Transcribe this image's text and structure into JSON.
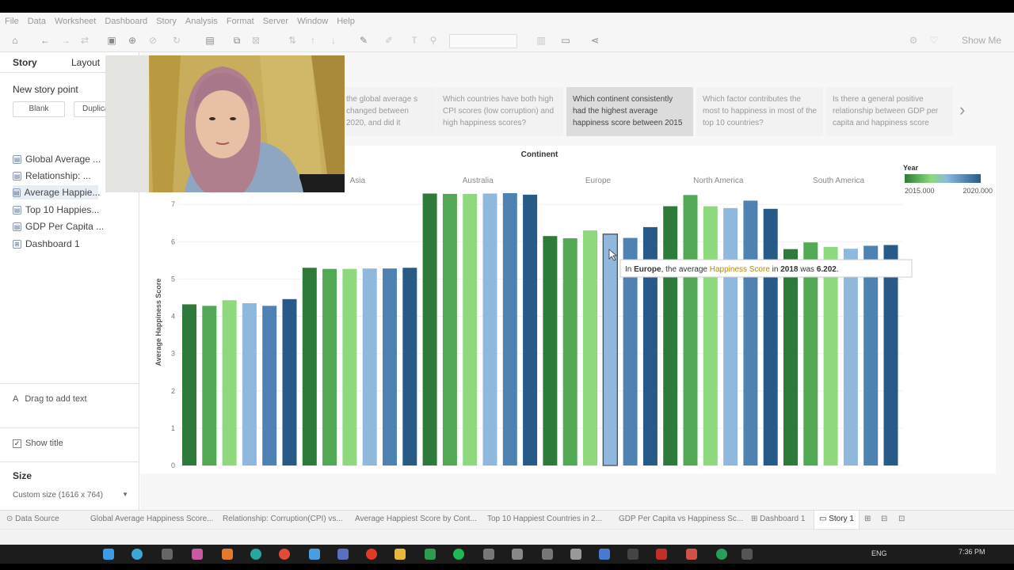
{
  "menu": [
    "File",
    "Data",
    "Worksheet",
    "Dashboard",
    "Story",
    "Analysis",
    "Format",
    "Server",
    "Window",
    "Help"
  ],
  "toolbar": {
    "show_me": "Show Me"
  },
  "left_panel": {
    "tab_story": "Story",
    "tab_layout": "Layout",
    "new_story_point": "New story point",
    "blank_button": "Blank",
    "duplicate_button": "Duplicate",
    "sheets": [
      "Global Average ...",
      "Relationship: ...",
      "Average Happie...",
      "Top 10 Happies...",
      "GDP Per Capita ...",
      "Dashboard 1"
    ],
    "drag_to_add_text": "Drag to add text",
    "show_title": "Show title",
    "size_heading": "Size",
    "size_value": "Custom size (1616 x 764)"
  },
  "story_points": [
    "the global average s changed between 2020, and did it",
    "Which countries have both high CPI scores (low corruption) and high happiness scores?",
    "Which continent consistently had the highest average happiness score between 2015",
    "Which factor contributes the most to happiness in most of the top 10 countries?",
    "Is there a general positive relationship between GDP per capita and happiness score"
  ],
  "active_story_point": 2,
  "tooltip": {
    "prefix": "In ",
    "continent": "Europe",
    "mid": ", the average ",
    "measure": "Happiness Score",
    "mid2": " in ",
    "year": "2018",
    "mid3": " was ",
    "value": "6.202",
    "suffix": "."
  },
  "chart_data": {
    "type": "bar",
    "header_title": "Continent",
    "ylabel": "Average Happiness Score",
    "ylim": [
      0,
      7.3
    ],
    "yticks": [
      0,
      1,
      2,
      3,
      4,
      5,
      6,
      7
    ],
    "legend": {
      "title": "Year",
      "min_label": "2015.000",
      "max_label": "2020.000"
    },
    "years": [
      2015,
      2016,
      2017,
      2018,
      2019,
      2020
    ],
    "year_colors": [
      "#2d7a3a",
      "#52a855",
      "#8ed97e",
      "#8fb8dc",
      "#4d82b3",
      "#285a88"
    ],
    "groups": [
      {
        "name": "",
        "values": [
          4.32,
          4.28,
          4.43,
          4.35,
          4.28,
          4.46
        ]
      },
      {
        "name": "Asia",
        "values": [
          5.3,
          5.27,
          5.27,
          5.28,
          5.28,
          5.3
        ]
      },
      {
        "name": "Australia",
        "values": [
          7.29,
          7.28,
          7.28,
          7.29,
          7.3,
          7.26
        ]
      },
      {
        "name": "Europe",
        "values": [
          6.15,
          6.09,
          6.3,
          6.202,
          6.1,
          6.39
        ]
      },
      {
        "name": "North America",
        "values": [
          6.95,
          7.25,
          6.95,
          6.9,
          7.1,
          6.88
        ]
      },
      {
        "name": "South America",
        "values": [
          5.8,
          5.98,
          5.86,
          5.81,
          5.89,
          5.91
        ]
      }
    ],
    "highlighted": {
      "group": 3,
      "bar": 3
    }
  },
  "sheet_tabs": [
    "Data Source",
    "Global Average Happiness Score...",
    "Relationship: Corruption(CPI) vs...",
    "Average Happiest Score by Cont...",
    "Top 10 Happiest Countries in 2...",
    "GDP Per Capita vs Happiness Sc...",
    "Dashboard 1",
    "Story 1"
  ],
  "taskbar": {
    "lang": "ENG",
    "time": "7:36 PM"
  }
}
